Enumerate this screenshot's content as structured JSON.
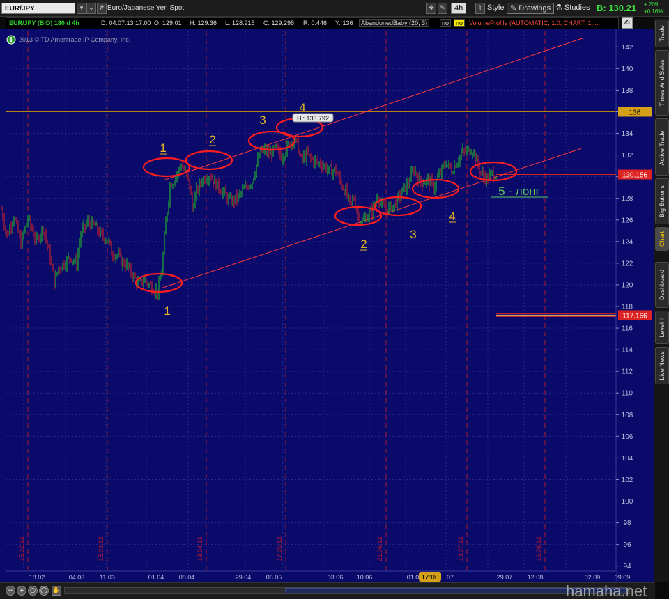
{
  "toolbar": {
    "symbol": "EUR/JPY",
    "description": "Euro/Japanese Yen Spot",
    "period": "4h",
    "style_label": "Style",
    "drawings_label": "Drawings",
    "studies_label": "Studies",
    "bid_label": "B: 130.21",
    "change_abs": "+.209",
    "change_pct": "+0.16%"
  },
  "info": {
    "symbol_period": "EUR/JPY (BID) 180 d 4h",
    "date": "D: 04.07.13 17:00",
    "open": "O: 129.01",
    "high": "H: 129.36",
    "low": "L: 128.915",
    "close": "C: 129.298",
    "range": "R: 0.446",
    "y": "Y: 136",
    "study": "AbandonedBaby (20, 3)",
    "no1": "no",
    "no2": "no",
    "volume_profile": "VolumeProfile (AUTOMATIC, 1.0, CHART, 1, ..."
  },
  "copyright": "2013 © TD Ameritrade IP Company, Inc.",
  "side_tabs": [
    "Trade",
    "Times And Sales",
    "Active Trader",
    "Big Buttons",
    "Chart",
    "Dashboard",
    "Level II",
    "Live News"
  ],
  "active_tab": "Chart",
  "watermark": "hamaha.net",
  "colors": {
    "background": "#0a0a6a",
    "grid": "#2b2b8a",
    "up": "#22cc22",
    "down": "#dd2222",
    "annotation": "#e6b422",
    "annotation_green": "#5ccf5c",
    "circle": "#ff1e1e",
    "trendline": "#ff3a3a",
    "horizontal_line": "#b8860b"
  },
  "chart_data": {
    "type": "candlestick",
    "y_axis": {
      "range": [
        92.5,
        143.5
      ],
      "ticks": [
        142,
        140,
        138,
        136,
        134,
        132,
        130,
        128,
        126,
        124,
        122,
        120,
        118,
        116,
        114,
        112,
        110,
        108,
        106,
        104,
        102,
        100,
        98,
        96,
        94
      ],
      "grid": true
    },
    "x_axis": {
      "tick_labels": [
        "18.02",
        "04.03",
        "11.03",
        "01.04",
        "08.04",
        "29.04",
        "06.05",
        "03.06",
        "10.06",
        "01.07",
        "17:00",
        "07",
        "29.07",
        "12.08",
        "02.09",
        "09.09"
      ]
    },
    "vertical_dates": [
      "15.02.13",
      "15.03.13",
      "19.04.13",
      "17.05.13",
      "21.06.13",
      "19.07.13",
      "16.08.13"
    ],
    "price_tags": [
      {
        "value": "136",
        "color": "#d4a017"
      },
      {
        "value": "130.156",
        "color": "#dd2222"
      },
      {
        "value": "117.166",
        "color": "#dd2222"
      }
    ],
    "high_callout": "Hi: 133.792",
    "horizontal_levels": [
      136,
      130.2,
      117.2
    ],
    "annotations": [
      {
        "text": "1",
        "underlined": false
      },
      {
        "text": "1",
        "underlined": true
      },
      {
        "text": "2",
        "underlined": true
      },
      {
        "text": "3",
        "underlined": false
      },
      {
        "text": "4",
        "underlined": false
      },
      {
        "text": "2",
        "underlined": true
      },
      {
        "text": "3",
        "underlined": false
      },
      {
        "text": "4",
        "underlined": true
      },
      {
        "text": "5 - лонг",
        "underlined": true
      }
    ],
    "price_path": [
      [
        2,
        127
      ],
      [
        10,
        124.5
      ],
      [
        20,
        126.4
      ],
      [
        30,
        123.8
      ],
      [
        40,
        126.2
      ],
      [
        52,
        124
      ],
      [
        62,
        125.3
      ],
      [
        72,
        122.5
      ],
      [
        78,
        120.2
      ],
      [
        84,
        121.6
      ],
      [
        92,
        122
      ],
      [
        100,
        122.6
      ],
      [
        110,
        122
      ],
      [
        116,
        124.8
      ],
      [
        126,
        125.8
      ],
      [
        136,
        125.4
      ],
      [
        146,
        124.5
      ],
      [
        155,
        124.2
      ],
      [
        160,
        123
      ],
      [
        168,
        122.8
      ],
      [
        175,
        122.1
      ],
      [
        182,
        121.8
      ],
      [
        190,
        120.9
      ],
      [
        198,
        120.1
      ],
      [
        208,
        120.4
      ],
      [
        218,
        119.8
      ],
      [
        226,
        119.3
      ],
      [
        232,
        121.2
      ],
      [
        238,
        125.8
      ],
      [
        244,
        129.2
      ],
      [
        252,
        130
      ],
      [
        260,
        131.1
      ],
      [
        266,
        130.4
      ],
      [
        272,
        129.2
      ],
      [
        276,
        127
      ],
      [
        282,
        128.6
      ],
      [
        290,
        129.7
      ],
      [
        300,
        130.2
      ],
      [
        310,
        129.3
      ],
      [
        320,
        128.6
      ],
      [
        330,
        127.7
      ],
      [
        340,
        128
      ],
      [
        350,
        128.8
      ],
      [
        356,
        129.2
      ],
      [
        362,
        129.6
      ],
      [
        368,
        131.1
      ],
      [
        374,
        132.2
      ],
      [
        380,
        132.4
      ],
      [
        388,
        132.1
      ],
      [
        396,
        132.6
      ],
      [
        404,
        131.8
      ],
      [
        412,
        132.7
      ],
      [
        420,
        133.4
      ],
      [
        426,
        133.1
      ],
      [
        432,
        131.5
      ],
      [
        440,
        132
      ],
      [
        452,
        131.4
      ],
      [
        462,
        131.2
      ],
      [
        472,
        130.6
      ],
      [
        482,
        130.6
      ],
      [
        490,
        129.2
      ],
      [
        496,
        128.6
      ],
      [
        502,
        127.4
      ],
      [
        508,
        128
      ],
      [
        514,
        126.4
      ],
      [
        520,
        125.8
      ],
      [
        526,
        126.3
      ],
      [
        534,
        126.8
      ],
      [
        542,
        128.4
      ],
      [
        548,
        127.2
      ],
      [
        556,
        127
      ],
      [
        566,
        127.4
      ],
      [
        576,
        128.5
      ],
      [
        586,
        129.4
      ],
      [
        594,
        130.7
      ],
      [
        604,
        129.4
      ],
      [
        614,
        129.7
      ],
      [
        622,
        129
      ],
      [
        632,
        130.4
      ],
      [
        640,
        131.3
      ],
      [
        648,
        130.6
      ],
      [
        656,
        131.4
      ],
      [
        662,
        132.2
      ],
      [
        670,
        132.4
      ],
      [
        678,
        132.5
      ],
      [
        684,
        131.4
      ],
      [
        690,
        130.4
      ],
      [
        698,
        129.8
      ],
      [
        706,
        130.3
      ],
      [
        712,
        130.2
      ]
    ]
  }
}
